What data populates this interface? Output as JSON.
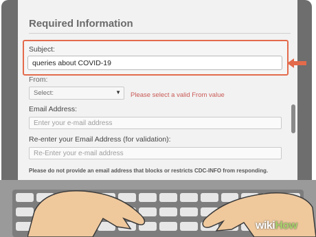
{
  "form": {
    "title": "Required Information",
    "subject": {
      "label": "Subject:",
      "value": "queries about COVID-19"
    },
    "from": {
      "label": "From:",
      "selected": "Select:",
      "error": "Please select a valid From value"
    },
    "email": {
      "label": "Email Address:",
      "placeholder": "Enter your e-mail address"
    },
    "email_confirm": {
      "label": "Re-enter your Email Address (for validation):",
      "placeholder": "Re-Enter your e-mail address"
    },
    "note": "Please do not provide an email address that blocks or restricts CDC-INFO from responding."
  },
  "colors": {
    "highlight": "#e36a4b",
    "error": "#c95a55",
    "skin": "#efc89c"
  },
  "watermark": {
    "wiki": "wiki",
    "how": "How"
  }
}
